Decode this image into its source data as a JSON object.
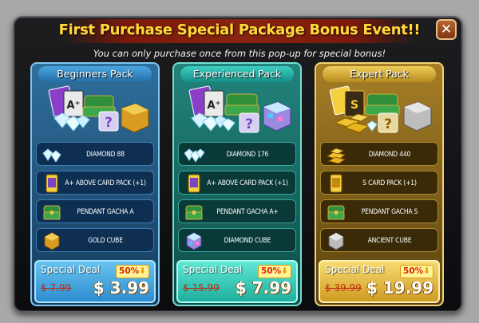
{
  "header": {
    "title": "First Purchase Special Package Bonus Event!!",
    "subtitle": "You can only purchase once from this pop-up for special bonus!",
    "close_icon": "close-icon"
  },
  "packs": [
    {
      "name": "Beginners Pack",
      "theme": "blue",
      "items": [
        {
          "label": "DIAMOND 88",
          "icon": "diamond-icon"
        },
        {
          "label": "A+ ABOVE CARD PACK (+1)",
          "icon": "card-pack-icon"
        },
        {
          "label": "PENDANT GACHA A",
          "icon": "chest-icon"
        },
        {
          "label": "GOLD CUBE",
          "icon": "gold-cube-icon"
        }
      ],
      "deal_label": "Special Deal",
      "discount": "50%",
      "old_price": "$ 7.99",
      "new_price": "$ 3.99"
    },
    {
      "name": "Experienced Pack",
      "theme": "teal",
      "items": [
        {
          "label": "DIAMOND 176",
          "icon": "diamond-icon"
        },
        {
          "label": "A+ ABOVE CARD PACK (+1)",
          "icon": "card-pack-icon"
        },
        {
          "label": "PENDANT GACHA A+",
          "icon": "chest-icon"
        },
        {
          "label": "DIAMOND CUBE",
          "icon": "diamond-cube-icon"
        }
      ],
      "deal_label": "Special Deal",
      "discount": "50%",
      "old_price": "$ 15.99",
      "new_price": "$ 7.99"
    },
    {
      "name": "Expert Pack",
      "theme": "gold",
      "items": [
        {
          "label": "DIAMOND 440",
          "icon": "gold-bars-icon"
        },
        {
          "label": "S CARD PACK (+1)",
          "icon": "card-pack-icon"
        },
        {
          "label": "PENDANT GACHA S",
          "icon": "chest-icon"
        },
        {
          "label": "ANCIENT CUBE",
          "icon": "ancient-cube-icon"
        }
      ],
      "deal_label": "Special Deal",
      "discount": "50%",
      "old_price": "$ 39.99",
      "new_price": "$ 19.99"
    }
  ],
  "colors": {
    "title": "#ffd93a",
    "blue_panel": "#2f6f9c",
    "teal_panel": "#22847c",
    "gold_panel": "#a67e25",
    "old_price": "#c12a10"
  }
}
